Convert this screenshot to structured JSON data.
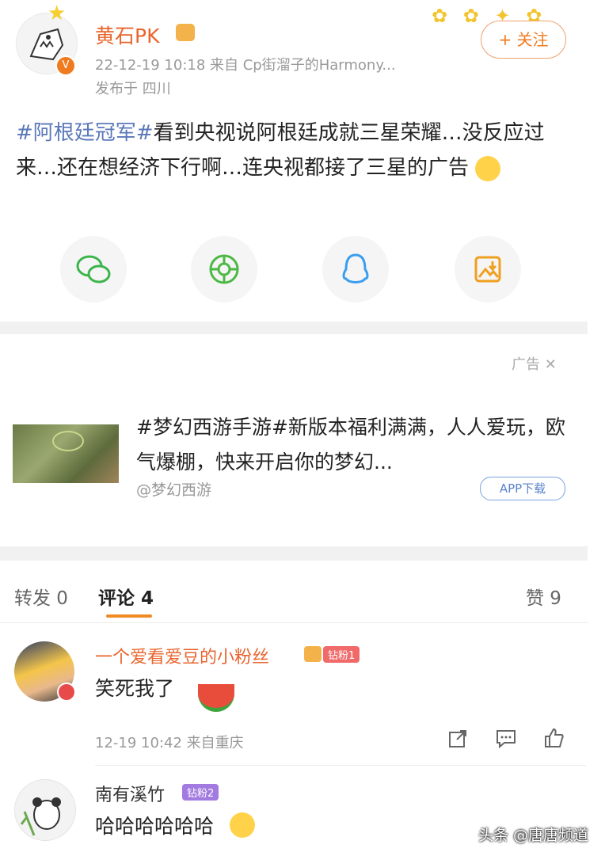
{
  "post": {
    "username": "黄石PK",
    "meta": "22-12-19 10:18  来自 Cp街溜子的Harmony...",
    "location": "发布于 四川",
    "follow_label": "+ 关注",
    "text_topic": "#阿根廷冠军#",
    "text_body": "看到央视说阿根廷成就三星荣耀…没反应过来…还在想经济下行啊…连央视都接了三星的广告",
    "username_color": "#e8652d"
  },
  "share": {
    "icons": [
      "wechat-icon",
      "moments-icon",
      "qq-icon",
      "save-image-icon"
    ]
  },
  "ad": {
    "tag": "广告",
    "title": "#梦幻西游手游#新版本福利满满，人人爱玩，欧气爆棚，快来开启你的梦幻...",
    "account": "@梦幻西游",
    "download": "APP下载"
  },
  "tabs": {
    "repost": "转发 0",
    "comment": "评论 4",
    "like": "赞 9",
    "active_color": "#f08a24"
  },
  "comments": [
    {
      "username": "一个爱看爱豆的小粉丝",
      "badge": "钻粉1",
      "text": "笑死我了",
      "meta": "12-19 10:42  来自重庆"
    },
    {
      "username": "南有溪竹",
      "badge": "钻粉2",
      "text": "哈哈哈哈哈哈"
    }
  ],
  "watermark": "头条 @唐唐频道"
}
